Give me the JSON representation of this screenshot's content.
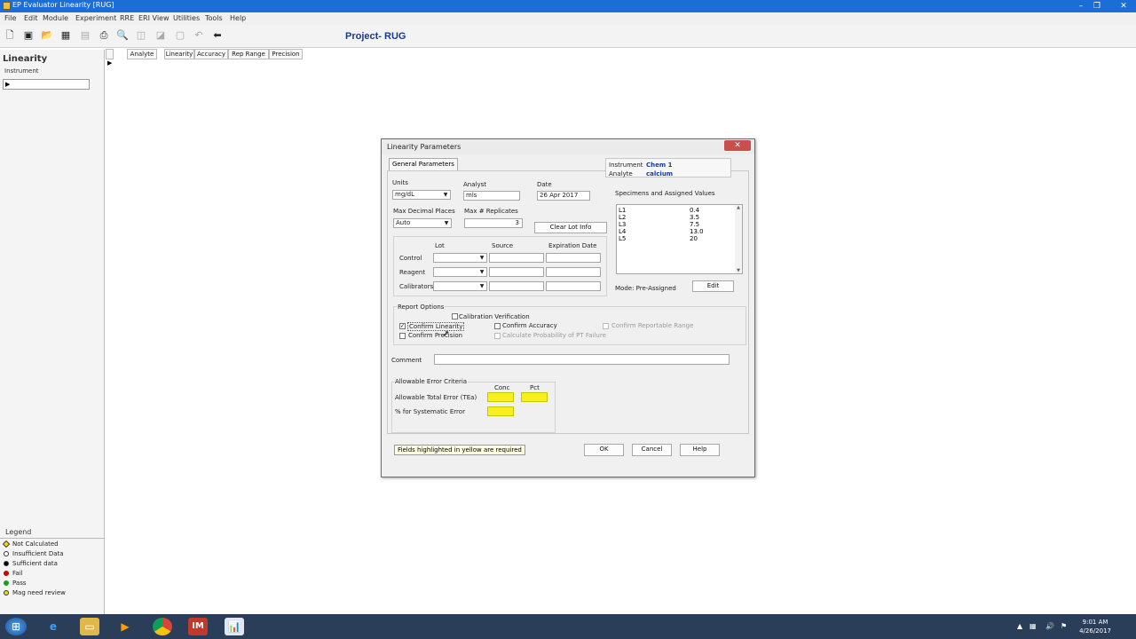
{
  "window": {
    "title": "EP Evaluator Linearity  [RUG]",
    "controls": [
      "–",
      "❐",
      "✕"
    ]
  },
  "menu": [
    "File",
    "Edit",
    "Module",
    "Experiment",
    "RRE",
    "ERI View",
    "Utilities",
    "Tools",
    "Help"
  ],
  "toolbar": {
    "icons": [
      "new-icon",
      "open-project-icon",
      "open-icon",
      "grid-icon",
      "calc-icon",
      "print-icon",
      "preview-icon",
      "disabled-icon-1",
      "disabled-icon-2",
      "disabled-icon-3",
      "undo-icon",
      "back-arrow-icon"
    ]
  },
  "project_title": "Project- RUG",
  "left_panel": {
    "heading": "Linearity",
    "sub": "Instrument"
  },
  "grid_headers": [
    "Analyte",
    "Linearity",
    "Accuracy",
    "Rep Range",
    "Precision"
  ],
  "legend": {
    "title": "Legend",
    "items": [
      {
        "label": "Not Calculated",
        "color": "#f5d90a"
      },
      {
        "label": "Insufficient Data",
        "color": "#ffffff"
      },
      {
        "label": "Sufficient data",
        "color": "#000000"
      },
      {
        "label": "Fail",
        "color": "#cc0000"
      },
      {
        "label": "Pass",
        "color": "#19a019"
      },
      {
        "label": "Mag need review",
        "color": "#e3e300"
      }
    ]
  },
  "dialog": {
    "title": "Linearity Parameters",
    "close": "✕",
    "tab": "General Parameters",
    "instrument_label": "Instrument",
    "instrument_value": "Chem 1",
    "analyte_label": "Analyte",
    "analyte_value": "calcium",
    "units_label": "Units",
    "units_value": "mg/dL",
    "analyst_label": "Analyst",
    "analyst_value": "mls",
    "date_label": "Date",
    "date_value": "26 Apr 2017",
    "max_decimal_label": "Max Decimal Places",
    "max_decimal_value": "Auto",
    "max_replicates_label": "Max # Replicates",
    "max_replicates_value": "3",
    "clear_lot_btn": "Clear Lot Info",
    "lot_header": "Lot",
    "source_header": "Source",
    "exp_header": "Expiration Date",
    "row_control": "Control",
    "row_reagent": "Reagent",
    "row_calibrators": "Calibrators",
    "specimens_label": "Specimens and Assigned Values",
    "specimens": [
      {
        "name": "L1",
        "value": "0.4"
      },
      {
        "name": "L2",
        "value": "3.5"
      },
      {
        "name": "L3",
        "value": "7.5"
      },
      {
        "name": "L4",
        "value": "13.0"
      },
      {
        "name": "L5",
        "value": "20"
      }
    ],
    "mode_label": "Mode: Pre-Assigned",
    "edit_btn": "Edit",
    "report_options_label": "Report Options",
    "calib_verification": "Calibration Verification",
    "confirm_linearity": "Confirm Linearity",
    "confirm_precision": "Confirm Precision",
    "confirm_accuracy": "Confirm Accuracy",
    "calc_probability": "Calculate Probability of PT Failure",
    "confirm_reportable": "Confirm Reportable Range",
    "confirm_linearity_checked": "✓",
    "comment_label": "Comment",
    "allowable_label": "Allowable Error Criteria",
    "conc_header": "Conc",
    "pct_header": "Pct",
    "tea_label": "Allowable Total Error (TEa)",
    "syserr_label": "% for Systematic Error",
    "required_note": "Fields highlighted in yellow are required",
    "ok_btn": "OK",
    "cancel_btn": "Cancel",
    "help_btn": "Help"
  },
  "taskbar": {
    "time": "9:01 AM",
    "date": "4/26/2017"
  }
}
